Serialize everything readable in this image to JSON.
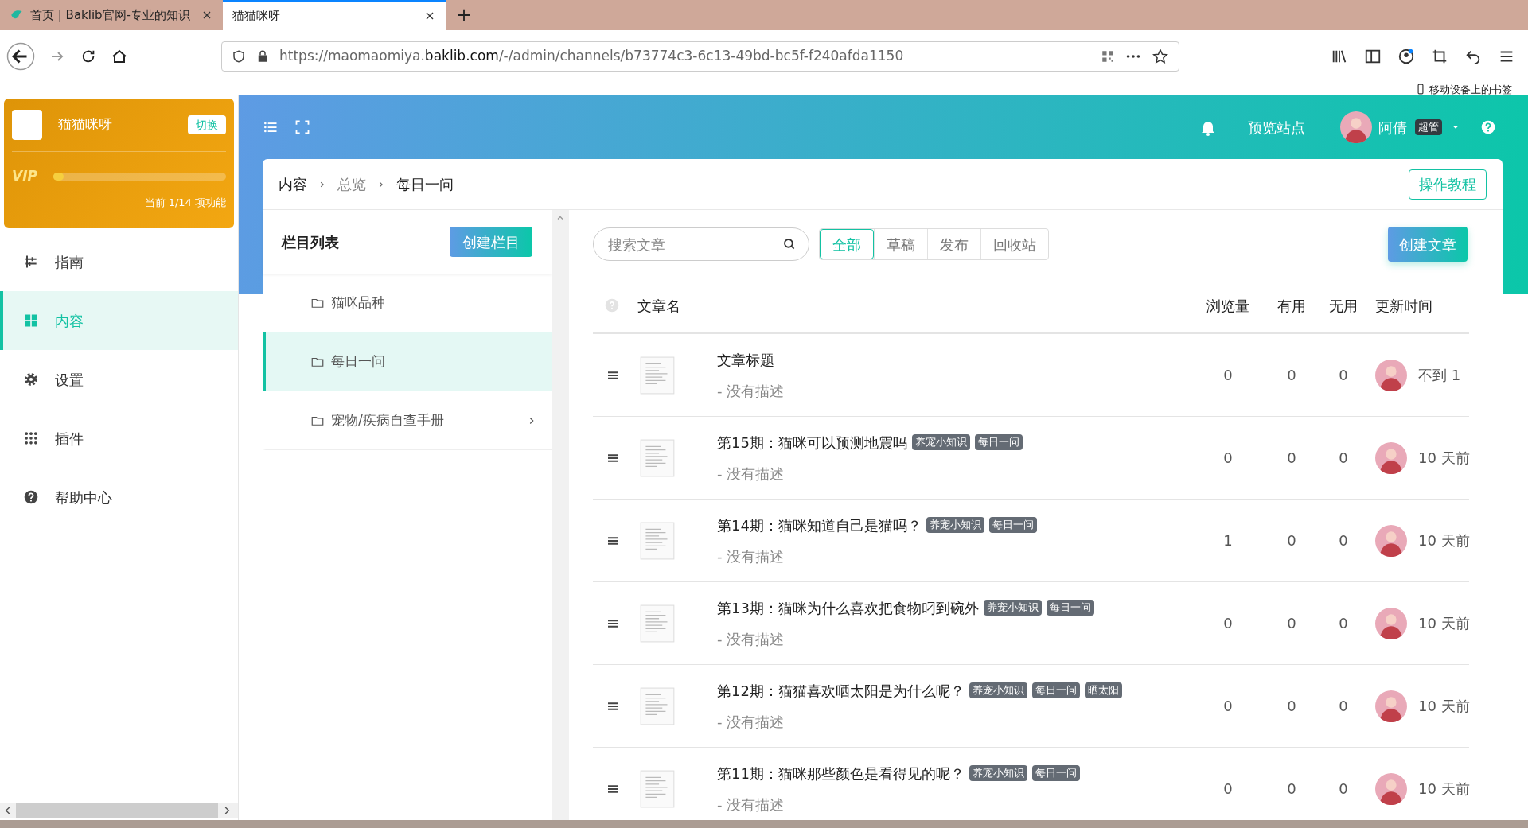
{
  "browser": {
    "tabs": [
      {
        "title": "首页 | Baklib官网-专业的知识",
        "selected": false
      },
      {
        "title": "猫猫咪呀",
        "selected": true
      }
    ],
    "url": {
      "prefix": "https://maomaomiya.",
      "domain": "baklib.com",
      "path": "/-/admin/channels/b73774c3-6c13-49bd-bc5f-f240afda1150"
    },
    "bookmarks_label": "移动设备上的书签"
  },
  "sidebar": {
    "site_name": "猫猫咪呀",
    "switch_button": "切换",
    "vip_label": "VIP",
    "vip": {
      "level": 0.06
    },
    "quota": "当前 1/14 项功能",
    "items": [
      {
        "kind": "guide",
        "label": "指南",
        "selected": false
      },
      {
        "kind": "content",
        "label": "内容",
        "selected": true
      },
      {
        "kind": "settings",
        "label": "设置",
        "selected": false
      },
      {
        "kind": "plugins",
        "label": "插件",
        "selected": false
      },
      {
        "kind": "help",
        "label": "帮助中心",
        "selected": false
      }
    ]
  },
  "header": {
    "preview": "预览站点",
    "user": "阿倩",
    "role": "超管"
  },
  "breadcrumb": [
    {
      "label": "内容",
      "link": false
    },
    {
      "label": "总览",
      "link": true
    },
    {
      "label": "每日一问",
      "link": false
    }
  ],
  "tutorial_button": "操作教程",
  "columns_panel": {
    "title": "栏目列表",
    "create_button": "创建栏目",
    "items": [
      {
        "label": "猫咪品种",
        "selected": false,
        "expandable": false
      },
      {
        "label": "每日一问",
        "selected": true,
        "expandable": false
      },
      {
        "label": "宠物/疾病自查手册",
        "selected": false,
        "expandable": true
      }
    ]
  },
  "articles": {
    "search": {
      "placeholder": "搜索文章"
    },
    "filters": [
      {
        "label": "全部",
        "selected": true
      },
      {
        "label": "草稿",
        "selected": false
      },
      {
        "label": "发布",
        "selected": false
      },
      {
        "label": "回收站",
        "selected": false
      }
    ],
    "create_button": "创建文章",
    "columns": [
      "文章名",
      "浏览量",
      "有用",
      "无用",
      "更新时间"
    ],
    "rows": [
      {
        "title": "文章标题",
        "tags": [],
        "description": "- 没有描述",
        "views": "0",
        "useful": "0",
        "useless": "0",
        "time": "不到 1"
      },
      {
        "title": "第15期：猫咪可以预测地震吗",
        "tags": [
          "养宠小知识",
          "每日一问"
        ],
        "description": "- 没有描述",
        "views": "0",
        "useful": "0",
        "useless": "0",
        "time": "10 天前"
      },
      {
        "title": "第14期：猫咪知道自己是猫吗？",
        "tags": [
          "养宠小知识",
          "每日一问"
        ],
        "description": "- 没有描述",
        "views": "1",
        "useful": "0",
        "useless": "0",
        "time": "10 天前"
      },
      {
        "title": "第13期：猫咪为什么喜欢把食物叼到碗外",
        "tags": [
          "养宠小知识",
          "每日一问"
        ],
        "description": "- 没有描述",
        "views": "0",
        "useful": "0",
        "useless": "0",
        "time": "10 天前"
      },
      {
        "title": "第12期：猫猫喜欢晒太阳是为什么呢？",
        "tags": [
          "养宠小知识",
          "每日一问",
          "晒太阳"
        ],
        "description": "- 没有描述",
        "views": "0",
        "useful": "0",
        "useless": "0",
        "time": "10 天前"
      },
      {
        "title": "第11期：猫咪那些颜色是看得见的呢？",
        "tags": [
          "养宠小知识",
          "每日一问"
        ],
        "description": "- 没有描述",
        "views": "0",
        "useful": "0",
        "useless": "0",
        "time": "10 天前"
      }
    ]
  }
}
